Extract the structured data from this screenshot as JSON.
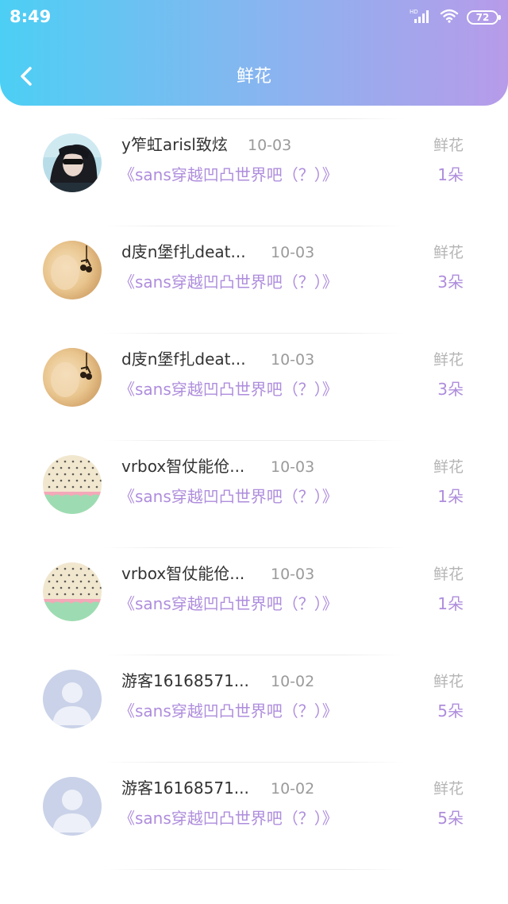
{
  "status_bar": {
    "time": "8:49",
    "battery": "72",
    "network_label": "HD"
  },
  "header": {
    "title": "鲜花",
    "back_icon": "chevron-left-icon",
    "gradient": [
      "#4ccff4",
      "#b79be9"
    ]
  },
  "colors": {
    "accent": "#ae8ddc",
    "name_text": "#333333",
    "muted_text": "#9a9a9a"
  },
  "list": [
    {
      "name": "",
      "date": "",
      "kind": "",
      "book": "《sans穿越凹凸世界吧（？）》",
      "count": "1朵",
      "avatar": "dark-portrait"
    },
    {
      "name": "y笮虹arisl致炫",
      "date": "10-03",
      "kind": "鲜花",
      "book": "《sans穿越凹凸世界吧（？）》",
      "count": "1朵",
      "avatar": "dark-portrait"
    },
    {
      "name": "d庋n堡f扎deat...",
      "date": "10-03",
      "kind": "鲜花",
      "book": "《sans穿越凹凸世界吧（？）》",
      "count": "3朵",
      "avatar": "earring-blur"
    },
    {
      "name": "d庋n堡f扎deat...",
      "date": "10-03",
      "kind": "鲜花",
      "book": "《sans穿越凹凸世界吧（？）》",
      "count": "3朵",
      "avatar": "earring-blur"
    },
    {
      "name": "vrbox智仗能伧...",
      "date": "10-03",
      "kind": "鲜花",
      "book": "《sans穿越凹凸世界吧（？）》",
      "count": "1朵",
      "avatar": "phone-case"
    },
    {
      "name": "vrbox智仗能伧...",
      "date": "10-03",
      "kind": "鲜花",
      "book": "《sans穿越凹凸世界吧（？）》",
      "count": "1朵",
      "avatar": "phone-case"
    },
    {
      "name": "游客16168571...",
      "date": "10-02",
      "kind": "鲜花",
      "book": "《sans穿越凹凸世界吧（？）》",
      "count": "5朵",
      "avatar": "default-user"
    },
    {
      "name": "游客16168571...",
      "date": "10-02",
      "kind": "鲜花",
      "book": "《sans穿越凹凸世界吧（？）》",
      "count": "5朵",
      "avatar": "default-user"
    }
  ]
}
